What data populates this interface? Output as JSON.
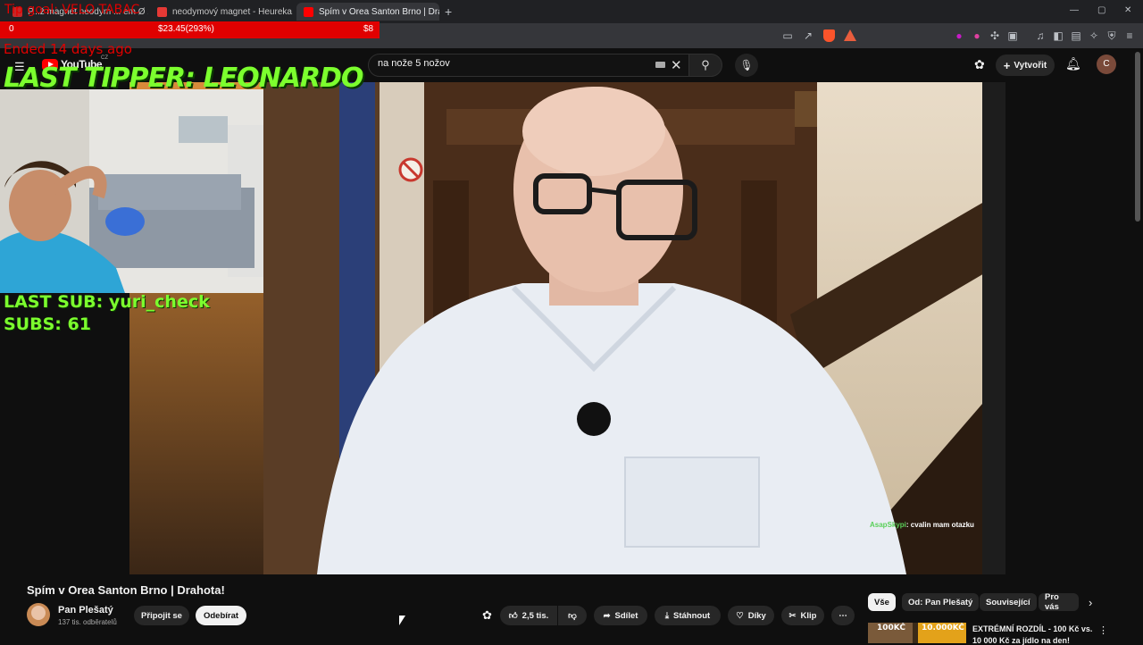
{
  "browser": {
    "tabs": [
      {
        "label": "P...ž magnet neodym ... em Ø 25",
        "active": false
      },
      {
        "label": "neodymový magnet - Heureka.cz",
        "active": false
      },
      {
        "label": "Spím v Orea Santon Brno | Drahota!",
        "active": true
      }
    ],
    "new_tab": "+",
    "window_controls": [
      "—",
      "▢",
      "✕"
    ]
  },
  "youtube": {
    "logo": "YouTube",
    "region": "CZ",
    "search_value": "na nože 5 nožov",
    "create_label": "Vytvořit",
    "avatar_letter": "C"
  },
  "overlay": {
    "goal_title": "Tip goal: VELO TABAC",
    "goal_current": "0",
    "goal_amount": "$23.45(293%)",
    "goal_target": "$8",
    "goal_ended": "Ended 14 days ago",
    "last_tipper": "LAST TIPPER: LEONARDO",
    "last_sub": "LAST SUB: yuri_check",
    "subs": "SUBS: 61"
  },
  "chat_message": {
    "user": "AsapSkypi",
    "text": ": cvalin mam otazku"
  },
  "video": {
    "title": "Spím v Orea Santon Brno | Drahota!",
    "channel": "Pan Plešatý",
    "subscribers": "137 tis. odběratelů",
    "join_label": "Připojit se",
    "subscribe_label": "Odebírat",
    "likes": "2,5 tis.",
    "share_label": "Sdílet",
    "download_label": "Stáhnout",
    "thanks_label": "Díky",
    "clip_label": "Klip",
    "more_label": "⋯"
  },
  "chips": [
    "Vše",
    "Od: Pan Plešatý",
    "Související",
    "Pro vás"
  ],
  "recommendation": {
    "thumb_text_1": "100KČ",
    "thumb_text_2": "10.000KČ",
    "title_line": "EXTRÉMNÍ ROZDÍL - 100 Kč vs.",
    "title_line2": "10 000 Kč za jídlo na den!"
  },
  "colors": {
    "overlay_green": "#7cff2e",
    "goal_red": "#e00000",
    "yt_red": "#ff0000"
  }
}
